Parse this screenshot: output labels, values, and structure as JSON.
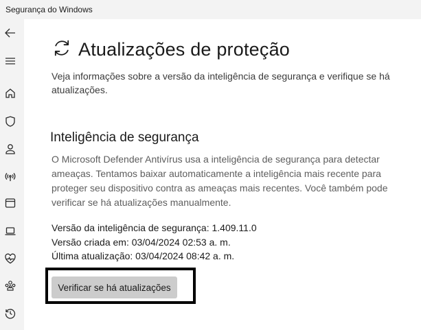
{
  "window": {
    "title": "Segurança do Windows"
  },
  "nav": {
    "icons": [
      "back-arrow-icon",
      "hamburger-menu-icon",
      "home-icon",
      "shield-icon",
      "person-icon",
      "wifi-antenna-icon",
      "app-browser-icon",
      "laptop-icon",
      "heart-pulse-icon",
      "family-icon",
      "history-icon"
    ]
  },
  "page": {
    "icon": "refresh-icon",
    "title": "Atualizações de proteção",
    "description": "Veja informações sobre a versão da inteligência de segurança e verifique se há atualizações."
  },
  "section": {
    "title": "Inteligência de segurança",
    "description": "O Microsoft Defender Antivírus usa a inteligência de segurança para detectar ameaças. Tentamos baixar automaticamente a inteligência mais recente para proteger seu dispositivo contra as ameaças mais recentes. Você também pode verificar se há atualizações manualmente."
  },
  "info": {
    "version": "Versão da inteligência de segurança: 1.409.11.0",
    "created": "Versão criada em: 03/04/2024 02:53 a. m.",
    "last_update": "Última atualização: 03/04/2024 08:42 a. m."
  },
  "actions": {
    "check_updates_label": "Verificar se há atualizações"
  },
  "colors": {
    "sidebar_bg": "#f3f3f3",
    "button_bg": "#cccccc",
    "highlight_border": "#000000"
  }
}
